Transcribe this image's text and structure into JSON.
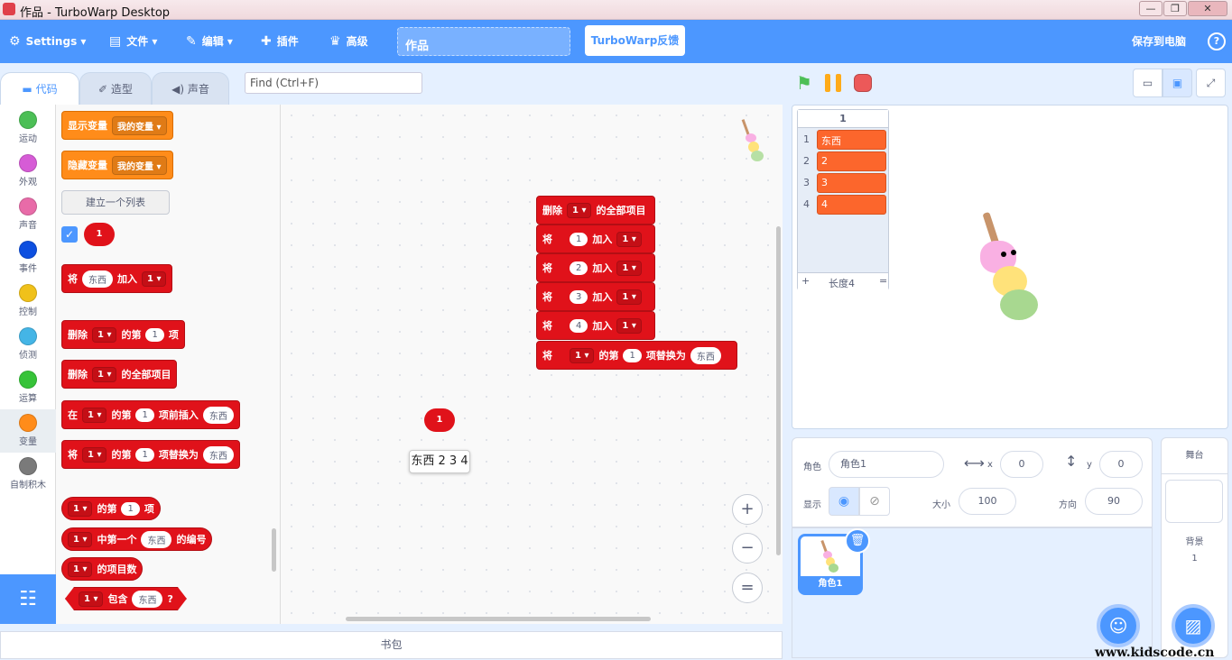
{
  "window": {
    "title": "作品 - TurboWarp Desktop",
    "minimize": "—",
    "maximize": "❐",
    "close": "✕"
  },
  "menu": {
    "settings": "Settings",
    "file": "文件",
    "edit": "编辑",
    "addons": "插件",
    "advanced": "高级",
    "project_title": "作品",
    "feedback": "TurboWarp反馈",
    "save": "保存到电脑"
  },
  "tabs": {
    "code": "代码",
    "costumes": "造型",
    "sounds": "声音"
  },
  "find": {
    "placeholder": "Find (Ctrl+F)"
  },
  "categories": [
    {
      "label": "运动",
      "color": "#4cbf56"
    },
    {
      "label": "外观",
      "color": "#d65cd6"
    },
    {
      "label": "声音",
      "color": "#e86ba8"
    },
    {
      "label": "事件",
      "color": "#0d4fe0"
    },
    {
      "label": "控制",
      "color": "#f0c11a"
    },
    {
      "label": "侦测",
      "color": "#44b5e6"
    },
    {
      "label": "运算",
      "color": "#36c338"
    },
    {
      "label": "变量",
      "color": "#ff8c1a"
    },
    {
      "label": "自制积木",
      "color": "#7a7a7a"
    }
  ],
  "palette": {
    "show_var": "显示变量",
    "hide_var": "隐藏变量",
    "my_var": "我的变量",
    "make_list": "建立一个列表",
    "list_name": "1",
    "add_to": "将",
    "thing": "东西",
    "add": "加入",
    "one": "1",
    "delete": "删除",
    "item_of": "的第",
    "item": "项",
    "delete_all": "的全部项目",
    "insert": "在",
    "insert_before": "项前插入",
    "replace": "项替换为",
    "first_index": "中第一个",
    "index_of": "的编号",
    "length": "的项目数",
    "contains": "包含",
    "q": "?"
  },
  "script": {
    "delete_all": "删除",
    "all_items": "的全部项目",
    "add_values": [
      "1",
      "2",
      "3",
      "4"
    ],
    "add_prefix": "将",
    "add_word": "加入",
    "list": "1",
    "replace_prefix": "将",
    "replace_item": "的第",
    "replace_index": "1",
    "replace_with": "项替换为",
    "replace_value": "东西"
  },
  "reporter": {
    "label": "1",
    "bubble": "东西 2 3 4"
  },
  "zoom": {
    "in": "+",
    "out": "−",
    "reset": "="
  },
  "list_monitor": {
    "title": "1",
    "items": [
      {
        "i": "1",
        "v": "东西"
      },
      {
        "i": "2",
        "v": "2"
      },
      {
        "i": "3",
        "v": "3"
      },
      {
        "i": "4",
        "v": "4"
      }
    ],
    "add": "+",
    "length": "长度4",
    "resize": "="
  },
  "sprite_info": {
    "sprite_label": "角色",
    "sprite_name": "角色1",
    "x_label": "x",
    "x": "0",
    "y_label": "y",
    "y": "0",
    "show_label": "显示",
    "size_label": "大小",
    "size": "100",
    "direction_label": "方向",
    "direction": "90"
  },
  "sprite_tile": {
    "name": "角色1"
  },
  "stage_selector": {
    "title": "舞台",
    "backdrops_label": "背景",
    "backdrops_count": "1"
  },
  "backpack": "书包",
  "watermark": "www.kidscode.cn"
}
